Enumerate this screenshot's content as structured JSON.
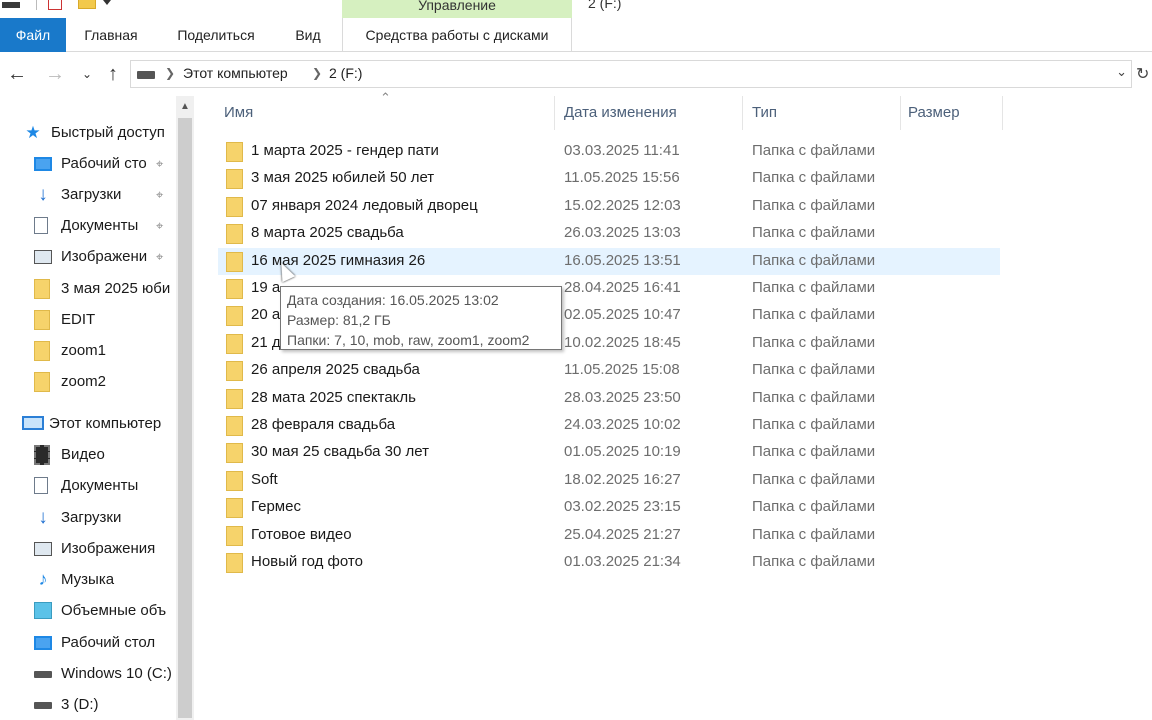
{
  "titlebar": {
    "context_tab": "Управление",
    "window_title": "2 (F:)"
  },
  "ribbon": {
    "tabs": [
      "Файл",
      "Главная",
      "Поделиться",
      "Вид",
      "Средства работы с дисками"
    ],
    "active_tab": "Файл",
    "accent_color": "#1979ca",
    "context_color": "#d6f0c0"
  },
  "address": {
    "segments": [
      "Этот компьютер",
      "2 (F:)"
    ]
  },
  "sidebar": {
    "items": [
      {
        "label": "Быстрый доступ",
        "icon": "quick-access-star-icon",
        "pinned": false
      },
      {
        "label": "Рабочий сто",
        "icon": "desktop-icon",
        "pinned": true
      },
      {
        "label": "Загрузки",
        "icon": "downloads-icon",
        "pinned": true
      },
      {
        "label": "Документы",
        "icon": "documents-icon",
        "pinned": true
      },
      {
        "label": "Изображени",
        "icon": "pictures-icon",
        "pinned": true
      },
      {
        "label": "3 мая 2025 юби",
        "icon": "folder-icon",
        "pinned": false
      },
      {
        "label": "EDIT",
        "icon": "folder-icon",
        "pinned": false
      },
      {
        "label": "zoom1",
        "icon": "folder-icon",
        "pinned": false
      },
      {
        "label": "zoom2",
        "icon": "folder-icon",
        "pinned": false
      },
      {
        "label": "Этот компьютер",
        "icon": "this-pc-icon",
        "pinned": false
      },
      {
        "label": "Видео",
        "icon": "video-icon",
        "pinned": false
      },
      {
        "label": "Документы",
        "icon": "documents-icon",
        "pinned": false
      },
      {
        "label": "Загрузки",
        "icon": "downloads-icon",
        "pinned": false
      },
      {
        "label": "Изображения",
        "icon": "pictures-icon",
        "pinned": false
      },
      {
        "label": "Музыка",
        "icon": "music-icon",
        "pinned": false
      },
      {
        "label": "Объемные объ",
        "icon": "3d-objects-icon",
        "pinned": false
      },
      {
        "label": "Рабочий стол",
        "icon": "desktop-icon",
        "pinned": false
      },
      {
        "label": "Windows 10 (C:)",
        "icon": "drive-icon",
        "pinned": false
      },
      {
        "label": "3 (D:)",
        "icon": "drive-icon",
        "pinned": false
      }
    ]
  },
  "columns": {
    "name": "Имя",
    "date": "Дата изменения",
    "type": "Тип",
    "size": "Размер"
  },
  "files": [
    {
      "name": "1 марта 2025 - гендер пати",
      "date": "03.03.2025 11:41",
      "type": "Папка с файлами"
    },
    {
      "name": "3 мая 2025 юбилей 50 лет",
      "date": "11.05.2025 15:56",
      "type": "Папка с файлами"
    },
    {
      "name": "07 января 2024 ледовый дворец",
      "date": "15.02.2025 12:03",
      "type": "Папка с файлами"
    },
    {
      "name": "8 марта 2025 свадьба",
      "date": "26.03.2025 13:03",
      "type": "Папка с файлами"
    },
    {
      "name": "16 мая 2025 гимназия 26",
      "date": "16.05.2025 13:51",
      "type": "Папка с файлами"
    },
    {
      "name": "19 а",
      "date": "28.04.2025 16:41",
      "type": "Папка с файлами"
    },
    {
      "name": "20 а",
      "date": "02.05.2025 10:47",
      "type": "Папка с файлами"
    },
    {
      "name": "21 д",
      "date": "10.02.2025 18:45",
      "type": "Папка с файлами"
    },
    {
      "name": "26 апреля 2025 свадьба",
      "date": "11.05.2025 15:08",
      "type": "Папка с файлами"
    },
    {
      "name": "28 мата 2025 спектакль",
      "date": "28.03.2025 23:50",
      "type": "Папка с файлами"
    },
    {
      "name": "28 февраля свадьба",
      "date": "24.03.2025 10:02",
      "type": "Папка с файлами"
    },
    {
      "name": "30 мая 25 свадьба 30 лет",
      "date": "01.05.2025 10:19",
      "type": "Папка с файлами"
    },
    {
      "name": "Soft",
      "date": "18.02.2025 16:27",
      "type": "Папка с файлами"
    },
    {
      "name": "Гермес",
      "date": "03.02.2025 23:15",
      "type": "Папка с файлами"
    },
    {
      "name": "Готовое видео",
      "date": "25.04.2025 21:27",
      "type": "Папка с файлами"
    },
    {
      "name": "Новый год фото",
      "date": "01.03.2025 21:34",
      "type": "Папка с файлами"
    }
  ],
  "hovered_index": 4,
  "tooltip": {
    "created": "Дата создания: 16.05.2025 13:02",
    "size": "Размер: 81,2 ГБ",
    "folders": "Папки: 7, 10, mob, raw, zoom1, zoom2"
  }
}
